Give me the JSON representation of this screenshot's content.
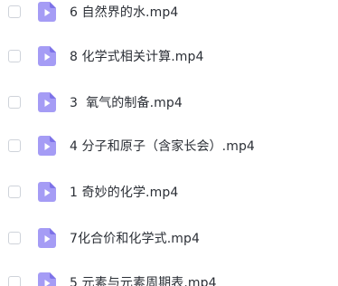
{
  "files": [
    {
      "name": "6 自然界的水.mp4"
    },
    {
      "name": "8 化学式相关计算.mp4"
    },
    {
      "name": "3  氧气的制备.mp4"
    },
    {
      "name": "4 分子和原子（含家长会）.mp4"
    },
    {
      "name": "1 奇妙的化学.mp4"
    },
    {
      "name": "7化合价和化学式.mp4"
    },
    {
      "name": "5 元素与元素周期表.mp4"
    }
  ],
  "colors": {
    "icon_fill": "#a59cf5",
    "icon_fold": "#7d72e8",
    "play_glyph": "#ffffff"
  },
  "icons": {
    "file": "video-file-icon",
    "checkbox": "checkbox"
  }
}
